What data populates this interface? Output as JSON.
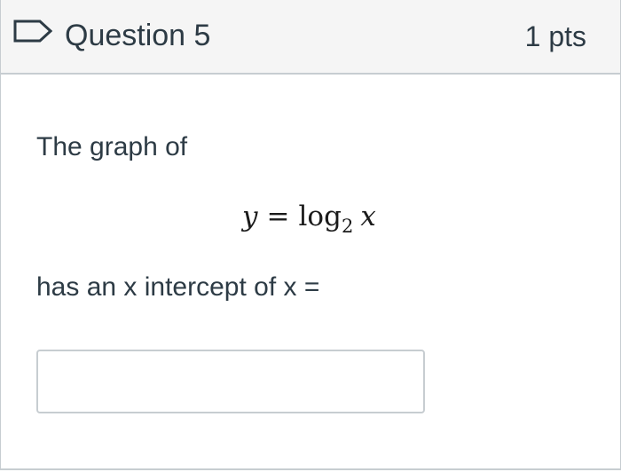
{
  "question": {
    "title": "Question 5",
    "points": "1 pts",
    "flag_icon": "bookmark-flag-outline-icon",
    "flag_color": "#2d3b45"
  },
  "content": {
    "intro_text": "The graph of",
    "equation": {
      "lhs": "y",
      "operator": "=",
      "function": "log",
      "base": "2",
      "argument": "x"
    },
    "prompt_text": "has an x intercept of x ="
  },
  "answer": {
    "value": "",
    "placeholder": ""
  },
  "colors": {
    "header_background": "#f5f5f5",
    "border": "#c7cdd1",
    "text": "#2d3b45"
  }
}
